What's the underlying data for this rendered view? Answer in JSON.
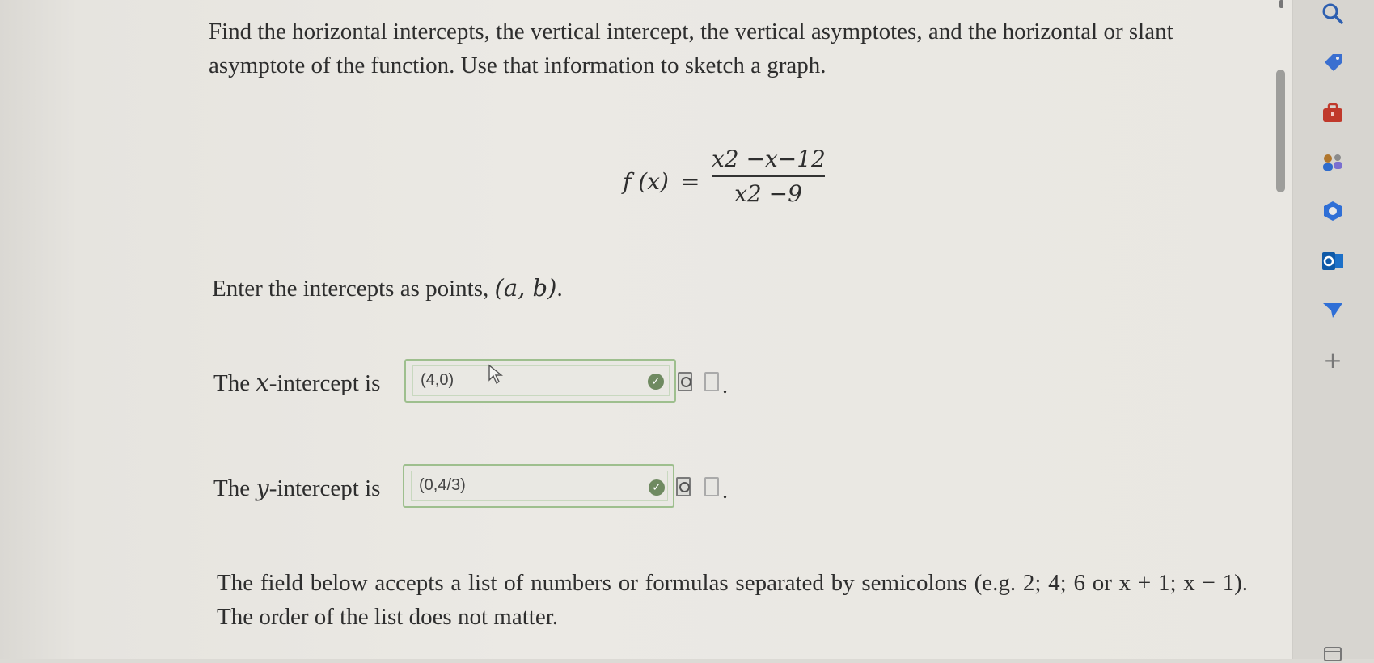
{
  "question": {
    "text": "Find the horizontal intercepts, the vertical intercept, the vertical asymptotes, and the horizontal or slant asymptote of the function. Use that information to sketch a graph."
  },
  "formula": {
    "lhs": "f (x)",
    "equals": "=",
    "numerator": "x2 −x−12",
    "denominator": "x2 −9"
  },
  "instructions": {
    "prefix": "Enter the intercepts as points, ",
    "notation": "(a, b)",
    "suffix": "."
  },
  "x_intercept": {
    "label_prefix": "The ",
    "label_var": "x",
    "label_suffix": "-intercept is",
    "value": "(4,0)",
    "status": "correct"
  },
  "y_intercept": {
    "label_prefix": "The ",
    "label_var": "y",
    "label_suffix": "-intercept is",
    "value": "(0,4/3)",
    "status": "correct"
  },
  "footer": {
    "text": "The field below accepts a list of numbers or formulas separated by semicolons (e.g. 2; 4; 6 or x + 1; x − 1). The order of the list does not matter."
  },
  "sidebar": {
    "icons": [
      "search-icon",
      "tag-icon",
      "briefcase-icon",
      "people-icon",
      "office-icon",
      "outlook-icon",
      "send-icon",
      "add-icon",
      "window-icon"
    ],
    "add_label": "+"
  },
  "colors": {
    "page_bg": "#ebe9e4",
    "input_border": "#9ebf8e",
    "check_green": "#6f8a61",
    "sidebar_bg": "#d7d5d0"
  }
}
